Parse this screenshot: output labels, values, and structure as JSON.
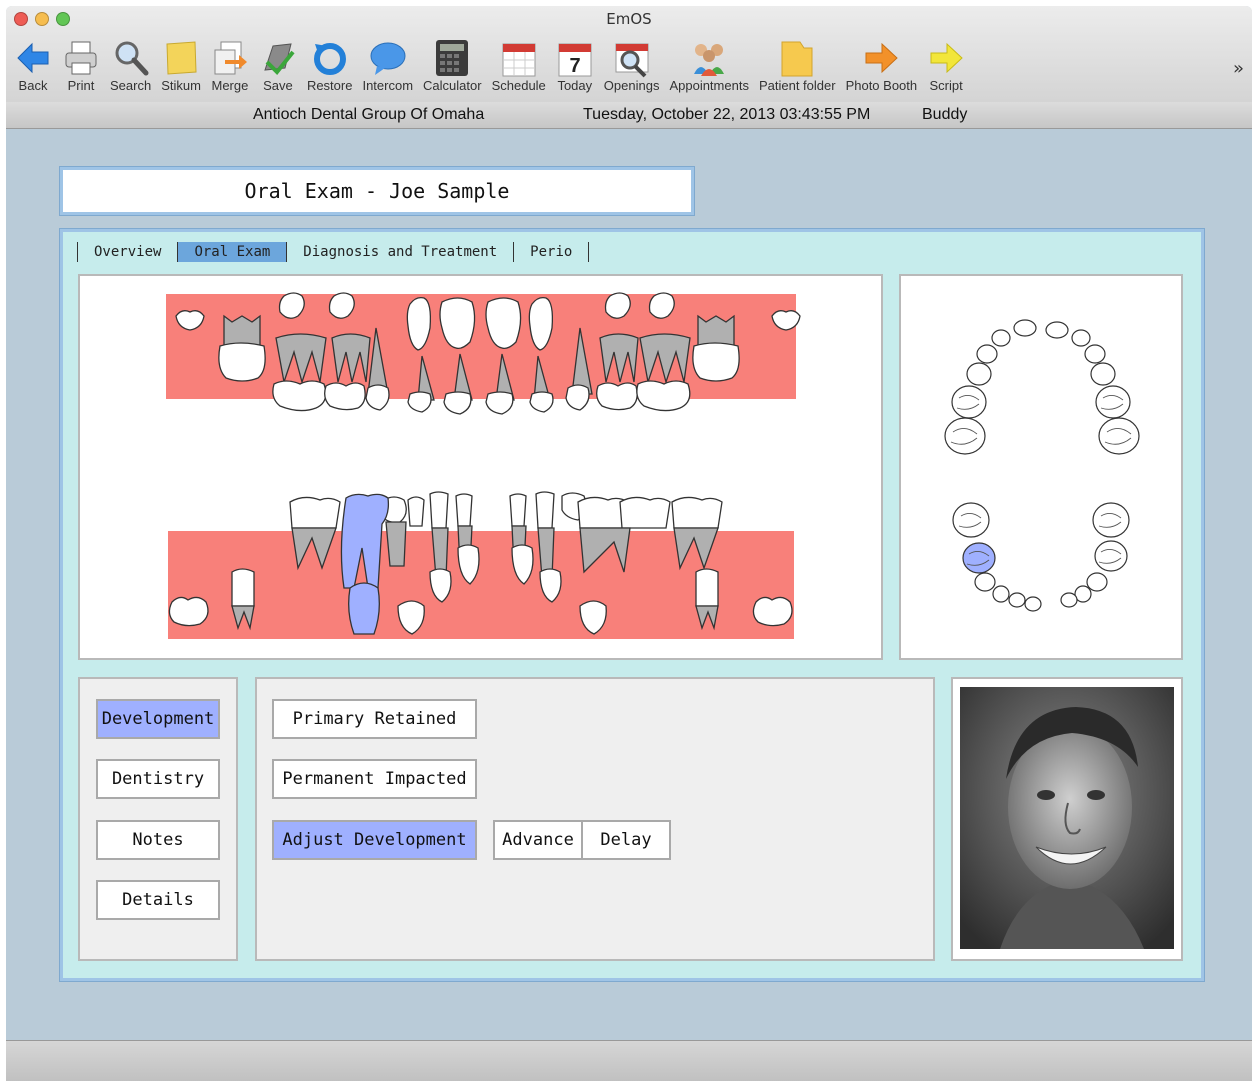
{
  "window": {
    "title": "EmOS"
  },
  "toolbar": {
    "items": [
      {
        "label": "Back",
        "icon": "back-arrow-icon"
      },
      {
        "label": "Print",
        "icon": "printer-icon"
      },
      {
        "label": "Search",
        "icon": "magnifier-icon"
      },
      {
        "label": "Stikum",
        "icon": "sticky-note-icon"
      },
      {
        "label": "Merge",
        "icon": "merge-icon"
      },
      {
        "label": "Save",
        "icon": "save-icon"
      },
      {
        "label": "Restore",
        "icon": "restore-icon"
      },
      {
        "label": "Intercom",
        "icon": "speech-bubble-icon"
      },
      {
        "label": "Calculator",
        "icon": "calculator-icon"
      },
      {
        "label": "Schedule",
        "icon": "calendar-icon"
      },
      {
        "label": "Today",
        "icon": "calendar-today-icon"
      },
      {
        "label": "Openings",
        "icon": "calendar-search-icon"
      },
      {
        "label": "Appointments",
        "icon": "people-icon"
      },
      {
        "label": "Patient folder",
        "icon": "folder-icon"
      },
      {
        "label": "Photo Booth",
        "icon": "orange-arrow-icon"
      },
      {
        "label": "Script",
        "icon": "yellow-arrow-icon"
      }
    ],
    "today_day": "7",
    "overflow": "»"
  },
  "infobar": {
    "practice": "Antioch Dental Group Of Omaha",
    "datetime": "Tuesday, October 22, 2013  03:43:55 PM",
    "user": "Buddy"
  },
  "exam": {
    "title": "Oral Exam - Joe Sample"
  },
  "tabs": [
    "Overview",
    "Oral Exam",
    "Diagnosis and Treatment",
    "Perio"
  ],
  "active_tab": "Oral Exam",
  "sections": {
    "development": "Development",
    "dentistry": "Dentistry",
    "notes": "Notes",
    "details": "Details"
  },
  "actions": {
    "primary_retained": "Primary Retained",
    "permanent_impacted": "Permanent Impacted",
    "adjust_development": "Adjust Development",
    "advance": "Advance",
    "delay": "Delay"
  },
  "colors": {
    "gum": "#f8807a",
    "selected_tooth": "#9fb0ff",
    "root": "#b0b0b0",
    "panel_bg": "#c6ecec",
    "window_bg": "#b9cbd8",
    "selected_button": "#9fb0ff",
    "active_tab": "#6ca6dc"
  }
}
